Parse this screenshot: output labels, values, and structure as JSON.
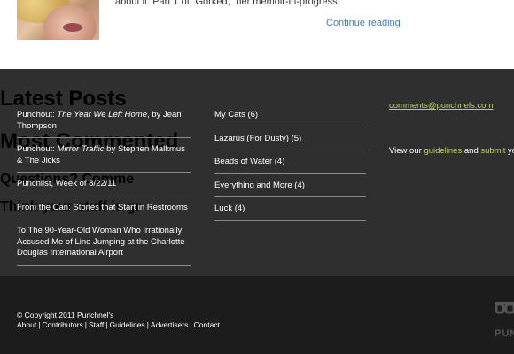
{
  "post": {
    "excerpt": "about it. Part 1 of “Gorked,” her memoir-in-progress.",
    "continue_label": "Continue reading"
  },
  "latest_posts": {
    "title": "Latest Posts",
    "items": [
      {
        "prefix": "Punchout: ",
        "italic": "The Year We Left Home",
        "suffix": ", by Jean Thompson"
      },
      {
        "prefix": "Punchout: ",
        "italic": "Mirror Traffic",
        "suffix": " by Stephen Malkmus & The Jicks"
      },
      {
        "prefix": "Punchlist, Week of 8/22/11",
        "italic": "",
        "suffix": ""
      },
      {
        "prefix": "From the Can: Stories that Start in Restrooms",
        "italic": "",
        "suffix": ""
      },
      {
        "prefix": "To The 90-Year-Old Woman Who Irrationally Accused Me of Line Jumping at the Charlotte Douglas International Airport",
        "italic": "",
        "suffix": ""
      }
    ]
  },
  "most_commented": {
    "title": "Most Commented",
    "items": [
      "My Cats (6)",
      "Lazarus (For Dusty) (5)",
      "Beads of Water (4)",
      "Everything and More (4)",
      "Luck (4)"
    ]
  },
  "questions": {
    "title": "Questions? Comme",
    "email": "comments@punchnels.com",
    "think_title": "Think your stuff is gr",
    "view_prefix": "View our ",
    "guidelines": "guidelines",
    "and": " and ",
    "submit": "submit",
    "view_suffix": " yo"
  },
  "footer": {
    "copyright": "© Copyright 2011 Punchnel's",
    "links": [
      "About",
      "Contributors",
      "Staff",
      "Guidelines",
      "Advertisers",
      "Contact"
    ],
    "logo_text": "PUN"
  },
  "colors": {
    "footer_bg": "#2f2f2f",
    "bottom_bg": "#1c1c1c",
    "link_blue": "#4b7ab7",
    "accent_green": "#b9d36a"
  }
}
